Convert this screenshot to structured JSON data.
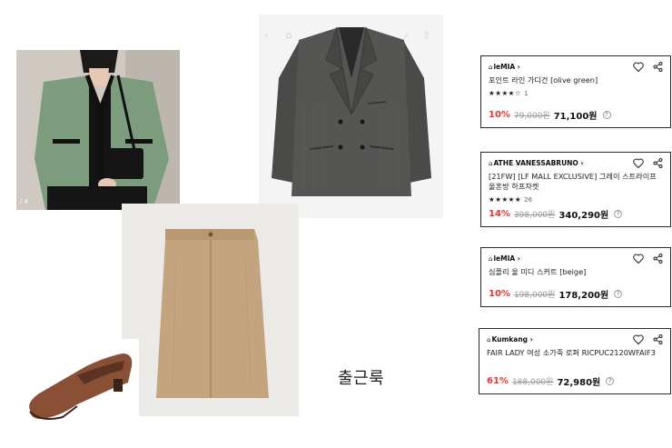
{
  "photos": {
    "cardigan": {
      "counter": "/ 4"
    },
    "jacket": {
      "nav_left": "‹",
      "nav_mid": "⌂",
      "nav_right": "⌕",
      "nav_right2": "⇧"
    }
  },
  "caption": "출근룩",
  "products": [
    {
      "brand_prefix": "⌂",
      "brand": "leMIA ›",
      "name": "포인트 라인 가디건 [olive green]",
      "stars": "★★★★☆",
      "review_count": "1",
      "discount": "10%",
      "original_price": "79,000원",
      "final_price": "71,100원",
      "info": "?"
    },
    {
      "brand_prefix": "⌂",
      "brand": "ATHE VANESSABRUNO ›",
      "name": "[21FW] [LF MALL EXCLUSIVE] 그레이 스트라이프 울혼방 하프자켓",
      "stars": "★★★★★",
      "review_count": "26",
      "discount": "14%",
      "original_price": "398,000원",
      "final_price": "340,290원",
      "info": "?"
    },
    {
      "brand_prefix": "⌂",
      "brand": "leMIA ›",
      "name": "심플리 울 미디 스커트 [beige]",
      "discount": "10%",
      "original_price": "198,000원",
      "final_price": "178,200원",
      "info": "?"
    },
    {
      "brand_prefix": "⌂",
      "brand": "Kumkang ›",
      "name": "FAIR LADY 여성 소가죽 로퍼 RICPUC2120WFAIF3",
      "discount": "61%",
      "original_price": "188,000원",
      "final_price": "72,980원",
      "info": "?"
    }
  ],
  "colors": {
    "discount": "#e2352f",
    "card_border": "#2a2a2a",
    "cardigan_green": "#7d9c7d",
    "jacket_gray": "#4e4f4c",
    "skirt_beige": "#c3a47e",
    "loafer_brown": "#8a5036"
  }
}
